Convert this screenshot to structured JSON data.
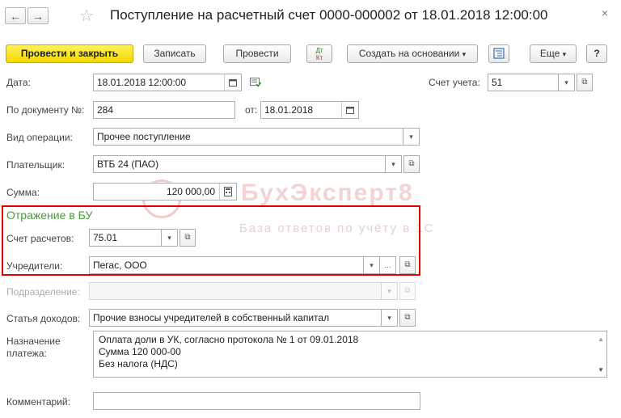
{
  "window": {
    "back_glyph": "←",
    "forward_glyph": "→",
    "favorite_glyph": "☆",
    "title": "Поступление на расчетный счет 0000-000002 от 18.01.2018 12:00:00",
    "close_glyph": "×"
  },
  "toolbar": {
    "post_close": "Провести и закрыть",
    "save": "Записать",
    "post": "Провести",
    "dtkt_top": "Дт",
    "dtkt_bottom": "Кт",
    "create_based": "Создать на основании",
    "more": "Еще",
    "help": "?",
    "dropdown_glyph": "▾"
  },
  "form": {
    "date_label": "Дата:",
    "date_value": "18.01.2018 12:00:00",
    "account_label": "Счет учета:",
    "account_value": "51",
    "doc_num_label": "По документу №:",
    "doc_num_value": "284",
    "from_label": "от:",
    "from_value": "18.01.2018",
    "op_type_label": "Вид операции:",
    "op_type_value": "Прочее поступление",
    "payer_label": "Плательщик:",
    "payer_value": "ВТБ 24 (ПАО)",
    "sum_label": "Сумма:",
    "sum_value": "120 000,00",
    "group_title": "Отражение в БУ",
    "settle_acc_label": "Счет расчетов:",
    "settle_acc_value": "75.01",
    "founders_label": "Учредители:",
    "founders_value": "Пегас, ООО",
    "division_label": "Подразделение:",
    "division_value": "",
    "income_label": "Статья доходов:",
    "income_value": "Прочие взносы учредителей в собственный капитал",
    "purpose_label_1": "Назначение",
    "purpose_label_2": "платежа:",
    "purpose_lines": [
      "Оплата доли в УК, согласно протокола № 1 от 09.01.2018",
      "Сумма 120 000-00",
      "Без налога (НДС)"
    ],
    "comment_label": "Комментарий:",
    "comment_value": ""
  },
  "watermark": {
    "brand": "БухЭксперт8",
    "tagline": "База ответов по учёту в 1С"
  },
  "colors": {
    "accent_yellow": "#f4d800",
    "highlight_red": "#e00000",
    "group_green": "#4a9a3a"
  }
}
